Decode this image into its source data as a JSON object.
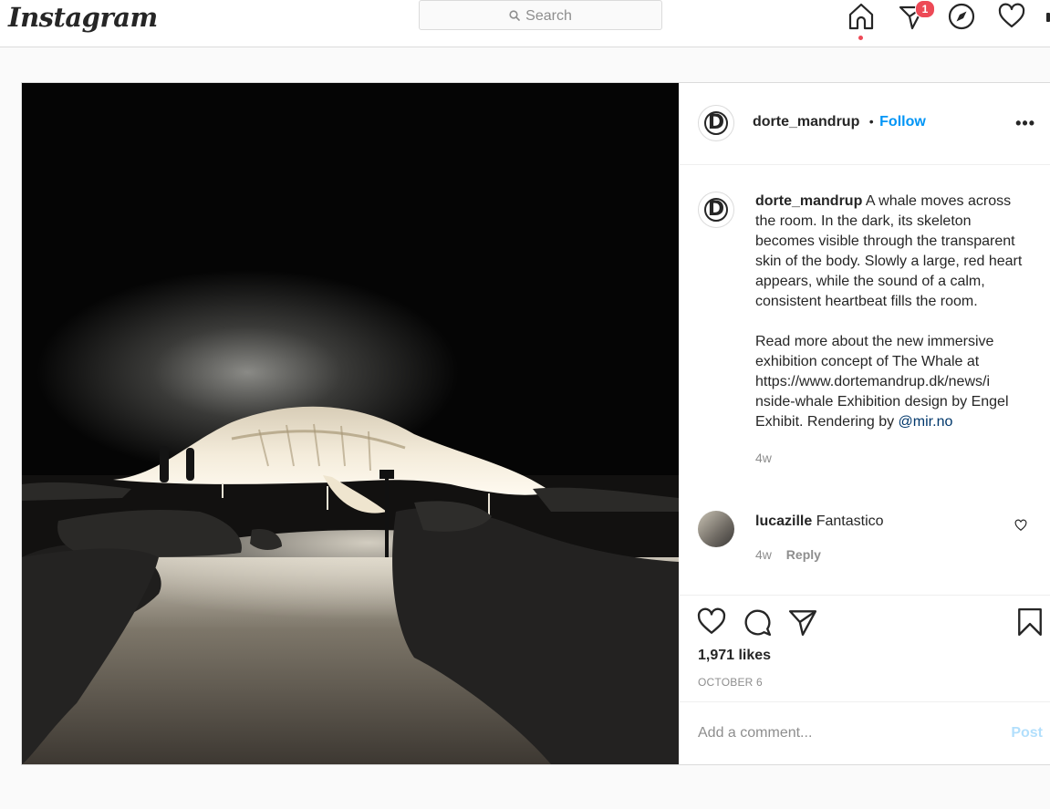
{
  "header": {
    "logo_text": "Instagram",
    "search_placeholder": "Search",
    "notification_count": "1",
    "icons": [
      "home-icon",
      "direct-message-icon",
      "explore-compass-icon",
      "activity-heart-icon"
    ]
  },
  "post": {
    "author": {
      "username": "dorte_mandrup",
      "avatar_letter": "D",
      "separator": "•",
      "follow_label": "Follow"
    },
    "caption": {
      "username": "dorte_mandrup",
      "paragraph_1": "A whale moves across the room. In the dark, its skeleton becomes visible through the transparent skin of the body. Slowly a large, red heart appears, while the sound of a calm, consistent heartbeat fills the room.",
      "paragraph_2": "Read more about the new immersive exhibition concept of The Whale at https://www.dortemandrup.dk/news/i nside-whale Exhibition design by Engel Exhibit. Rendering by",
      "mention": "@mir.no",
      "age": "4w"
    },
    "comments": [
      {
        "username": "lucazille",
        "text": "Fantastico",
        "age": "4w",
        "reply_label": "Reply"
      }
    ],
    "likes": "1,971 likes",
    "date": "OCTOBER 6",
    "add_comment_placeholder": "Add a comment...",
    "post_button": "Post"
  },
  "colors": {
    "accent_blue": "#0095f6",
    "post_button_disabled": "#b2dffc",
    "badge_red": "#ed4956",
    "border": "#dbdbdb",
    "text": "#262626",
    "muted": "#8e8e8e"
  }
}
